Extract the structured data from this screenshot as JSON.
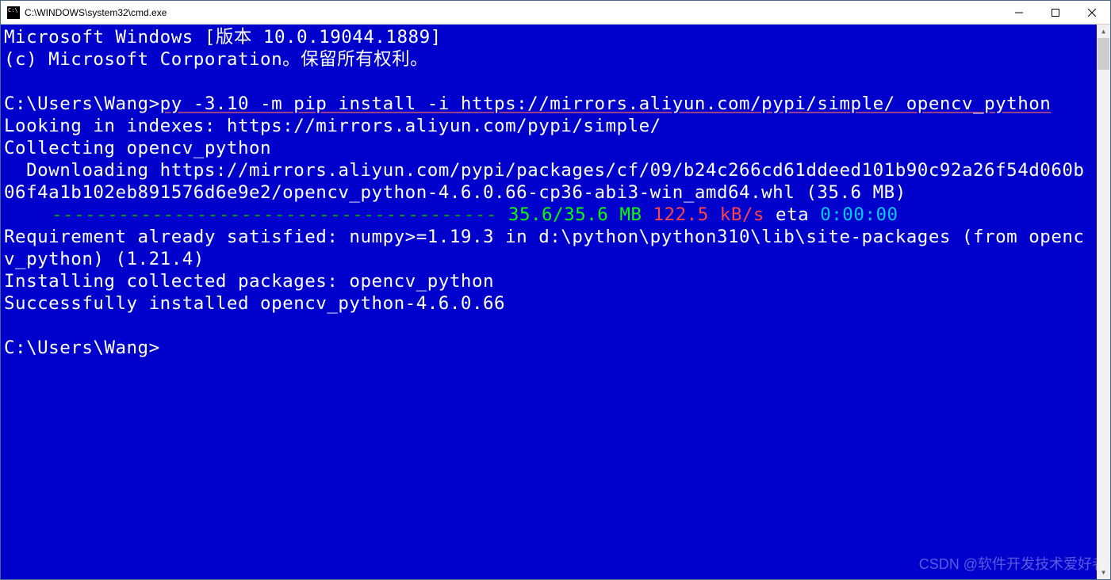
{
  "titlebar": {
    "title": "C:\\WINDOWS\\system32\\cmd.exe"
  },
  "terminal": {
    "header_line1": "Microsoft Windows [版本 10.0.19044.1889]",
    "header_line2": "(c) Microsoft Corporation。保留所有权利。",
    "prompt1_prefix": "C:\\Users\\Wang>",
    "prompt1_command": "py -3.10 -m pip install -i https://mirrors.aliyun.com/pypi/simple/ opencv_python",
    "output_line1": "Looking in indexes: https://mirrors.aliyun.com/pypi/simple/",
    "output_line2": "Collecting opencv_python",
    "output_line3": "  Downloading https://mirrors.aliyun.com/pypi/packages/cf/09/b24c266cd61ddeed101b90c92a26f54d060b06f4a1b102eb891576d6e9e2/opencv_python-4.6.0.66-cp36-abi3-win_amd64.whl (35.6 MB)",
    "progress": {
      "bar": "---------------------------------------- ",
      "size": "35.6/35.6 MB",
      "speed": " 122.5 kB/s",
      "eta_label": " eta ",
      "eta": "0:00:00"
    },
    "output_line5": "Requirement already satisfied: numpy>=1.19.3 in d:\\python\\python310\\lib\\site-packages (from opencv_python) (1.21.4)",
    "output_line6": "Installing collected packages: opencv_python",
    "output_line7": "Successfully installed opencv_python-4.6.0.66",
    "prompt2": "C:\\Users\\Wang>"
  },
  "watermark": "CSDN @软件开发技术爱好者"
}
